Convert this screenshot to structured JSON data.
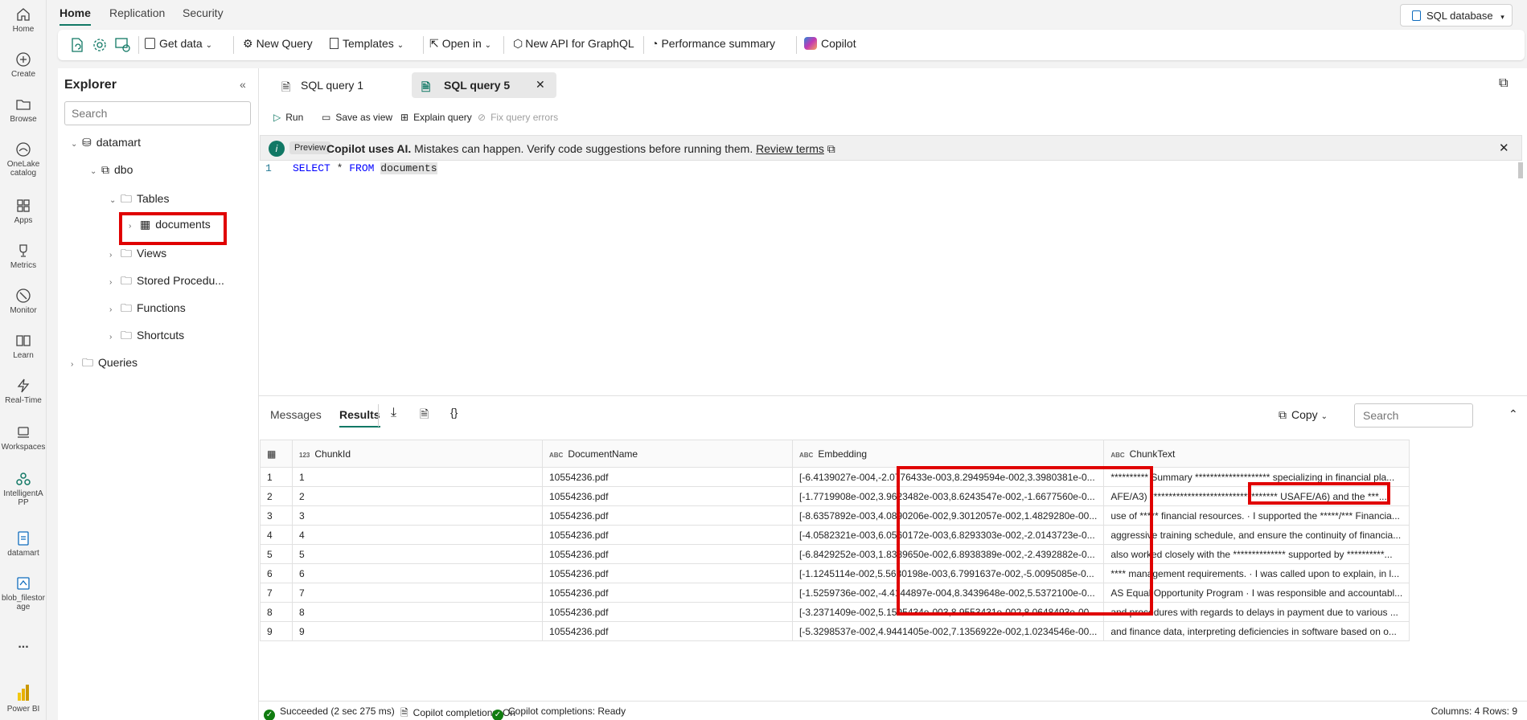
{
  "rail": {
    "home": "Home",
    "create": "Create",
    "browse": "Browse",
    "onelake": "OneLake catalog",
    "apps": "Apps",
    "metrics": "Metrics",
    "monitor": "Monitor",
    "learn": "Learn",
    "realtime": "Real-Time",
    "workspaces": "Workspaces",
    "intelligentapp": "IntelligentA PP",
    "datamart": "datamart",
    "blob": "blob_filestor age",
    "more": "...",
    "powerbi": "Power BI"
  },
  "top_tabs": [
    "Home",
    "Replication",
    "Security"
  ],
  "db_selector": "SQL database",
  "ribbon": {
    "get_data": "Get data",
    "new_query": "New Query",
    "templates": "Templates",
    "open_in": "Open in",
    "new_api": "New API for GraphQL",
    "perf": "Performance summary",
    "copilot": "Copilot"
  },
  "explorer": {
    "title": "Explorer",
    "search_placeholder": "Search",
    "tree": {
      "datamart": "datamart",
      "dbo": "dbo",
      "tables": "Tables",
      "documents": "documents",
      "views": "Views",
      "stored": "Stored Procedu...",
      "functions": "Functions",
      "shortcuts": "Shortcuts",
      "queries": "Queries"
    }
  },
  "query_tabs": [
    "SQL query 1",
    "SQL query 5"
  ],
  "toolbar": {
    "run": "Run",
    "save_as_view": "Save as view",
    "explain": "Explain query",
    "fix": "Fix query errors"
  },
  "banner": {
    "preview": "Preview",
    "copilot_uses_ai": "Copilot uses AI.",
    "message": "Mistakes can happen. Verify code suggestions before running them.",
    "link": "Review terms"
  },
  "code": {
    "line": "1",
    "select": "SELECT",
    "star": "*",
    "from": "FROM",
    "table": "documents"
  },
  "results": {
    "tabs": [
      "Messages",
      "Results"
    ],
    "copy": "Copy",
    "search_placeholder": "Search",
    "columns": [
      {
        "type": "123",
        "name": "ChunkId"
      },
      {
        "type": "ABC",
        "name": "DocumentName"
      },
      {
        "type": "ABC",
        "name": "Embedding"
      },
      {
        "type": "ABC",
        "name": "ChunkText"
      }
    ],
    "rows": [
      [
        "1",
        "1",
        "10554236.pdf",
        "[-6.4139027e-004,-2.0776433e-003,8.2949594e-002,3.3980381e-0...",
        "********** Summary ******************** specializing in financial pla..."
      ],
      [
        "2",
        "2",
        "10554236.pdf",
        "[-1.7719908e-002,3.9623482e-003,8.6243547e-002,-1.6677560e-0...",
        "AFE/A3) ********************************** USAFE/A6) and the ***..."
      ],
      [
        "3",
        "3",
        "10554236.pdf",
        "[-8.6357892e-003,4.0890206e-002,9.3012057e-002,1.4829280e-00...",
        "use of ***** financial resources. · I supported the *****/*** Financia..."
      ],
      [
        "4",
        "4",
        "10554236.pdf",
        "[-4.0582321e-003,6.0560172e-003,6.8293303e-002,-2.0143723e-0...",
        "aggressive training schedule, and ensure the continuity of financia..."
      ],
      [
        "5",
        "5",
        "10554236.pdf",
        "[-6.8429252e-003,1.8389650e-002,6.8938389e-002,-2.4392882e-0...",
        "also worked closely with the ************** supported by **********..."
      ],
      [
        "6",
        "6",
        "10554236.pdf",
        "[-1.1245114e-002,5.5630198e-003,6.7991637e-002,-5.0095085e-0...",
        "**** management requirements. · I was called upon to explain, in l..."
      ],
      [
        "7",
        "7",
        "10554236.pdf",
        "[-1.5259736e-002,-4.4144897e-004,8.3439648e-002,5.5372100e-0...",
        "AS Equal Opportunity Program · I was responsible and accountabl..."
      ],
      [
        "8",
        "8",
        "10554236.pdf",
        "[-3.2371409e-002,5.1595434e-003,8.9553431e-002,8.0648493e-00...",
        "and procedures with regards to delays in payment due to various ..."
      ],
      [
        "9",
        "9",
        "10554236.pdf",
        "[-5.3298537e-002,4.9441405e-002,7.1356922e-002,1.0234546e-00...",
        "and finance data, interpreting deficiencies in software based on o..."
      ]
    ]
  },
  "status": {
    "succeeded": "Succeeded (2 sec 275 ms)",
    "completions_on": "Copilot completions: On",
    "completions_ready": "Copilot completions: Ready",
    "summary": "Columns: 4 Rows: 9"
  },
  "colors": {
    "accent": "#117865",
    "highlight": "#e00000",
    "success": "#107c10"
  }
}
